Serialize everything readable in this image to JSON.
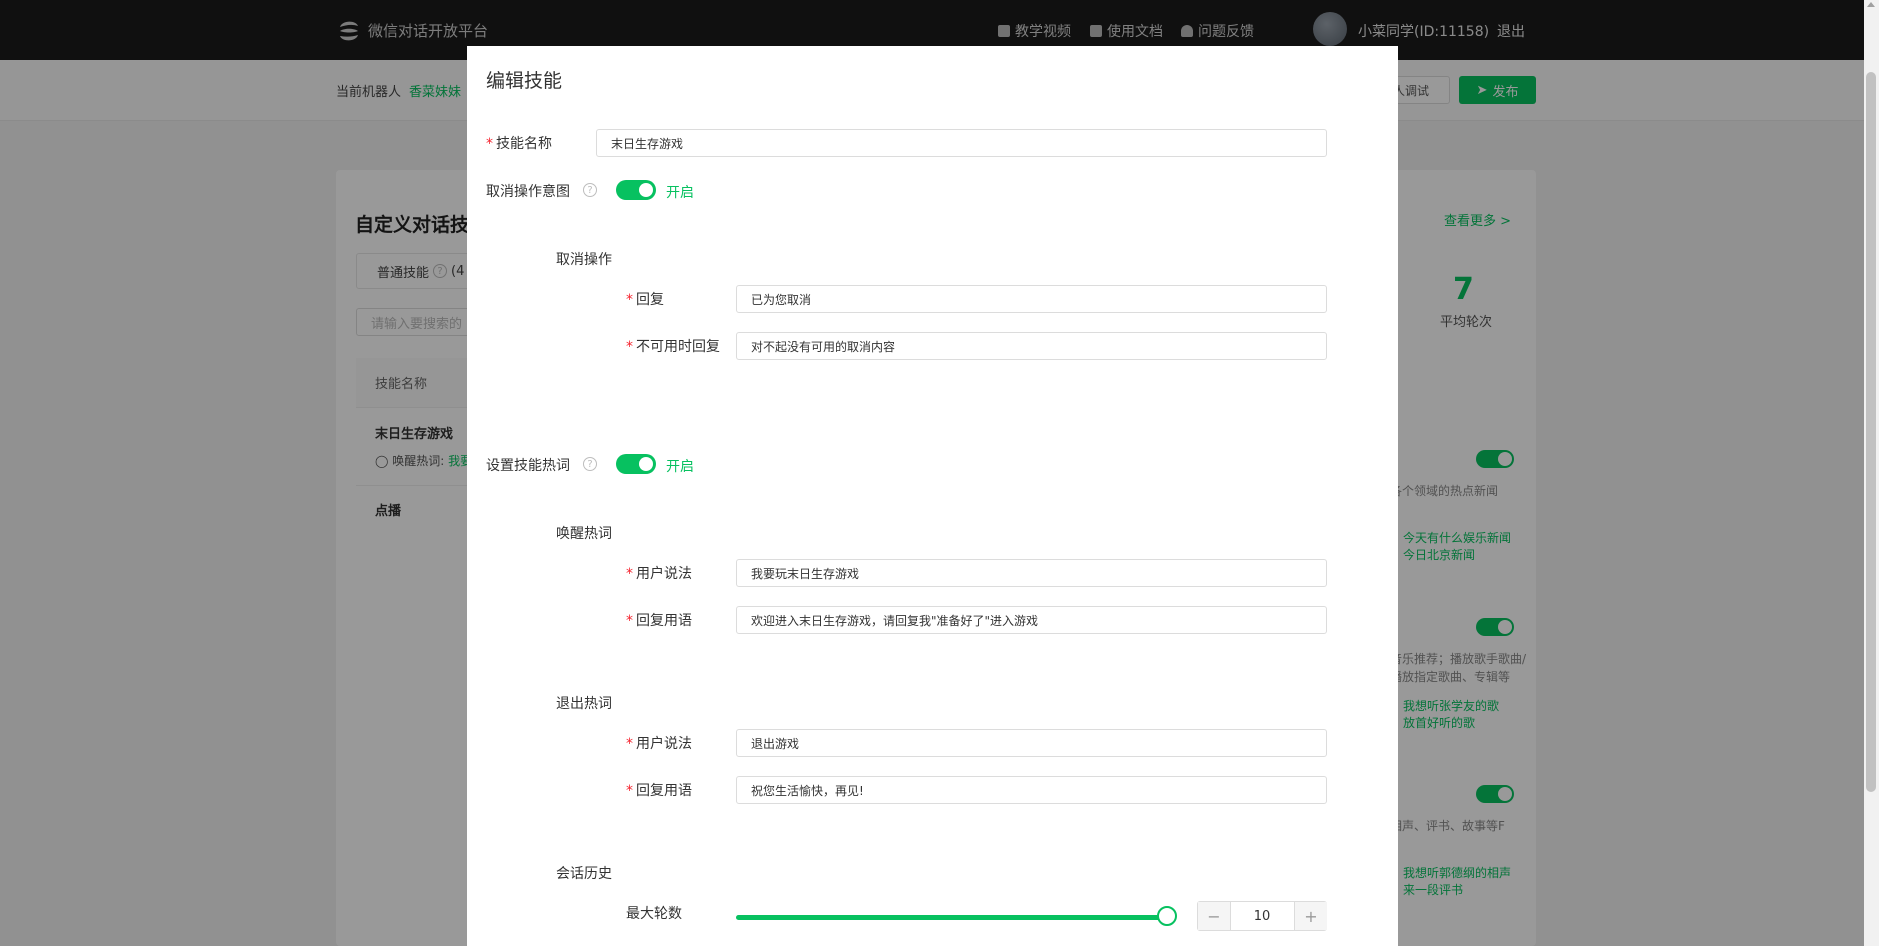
{
  "header": {
    "brand": "微信对话开放平台",
    "nav": [
      "教学视频",
      "使用文档",
      "问题反馈"
    ],
    "user": "小菜同学(ID:11158)",
    "logout": "退出"
  },
  "subbar": {
    "robot_label": "当前机器人",
    "robot_name": "香菜妹妹",
    "debug_button": "人调试",
    "publish_button": "发布"
  },
  "background": {
    "section_title": "自定义对话技",
    "tab_normal": "普通技能",
    "tab_count": "(4",
    "search_placeholder": "请输入要搜索的",
    "col_skill_name": "技能名称",
    "row1_name": "末日生存游戏",
    "row1_wake_label": "唤醒热词:",
    "row1_wake_value": "我要",
    "row2_name": "点播",
    "view_more": "查看更多 >",
    "stat_value": "7",
    "stat_label": "平均轮次",
    "cards": [
      {
        "desc": "各个领域的热点新闻",
        "examples": [
          "今天有什么娱乐新闻",
          "今日北京新闻"
        ]
      },
      {
        "desc": "音乐推荐；播放歌手歌曲/播放指定歌曲、专辑等",
        "examples": [
          "我想听张学友的歌",
          "放首好听的歌"
        ]
      },
      {
        "desc": "相声、评书、故事等F",
        "examples": [
          "我想听郭德纲的相声",
          "来一段评书"
        ]
      }
    ]
  },
  "modal": {
    "title": "编辑技能",
    "skill_name_label": "技能名称",
    "skill_name_value": "末日生存游戏",
    "cancel_intent_label": "取消操作意图",
    "cancel_intent_state": "开启",
    "cancel_section": "取消操作",
    "reply_label": "回复",
    "reply_value": "已为您取消",
    "unavailable_label": "不可用时回复",
    "unavailable_value": "对不起没有可用的取消内容",
    "hotword_label": "设置技能热词",
    "hotword_state": "开启",
    "wake_section": "唤醒热词",
    "wake_user_label": "用户说法",
    "wake_user_value": "我要玩末日生存游戏",
    "wake_reply_label": "回复用语",
    "wake_reply_value": "欢迎进入末日生存游戏，请回复我\"准备好了\"进入游戏",
    "exit_section": "退出热词",
    "exit_user_label": "用户说法",
    "exit_user_value": "退出游戏",
    "exit_reply_label": "回复用语",
    "exit_reply_value": "祝您生活愉快，再见!",
    "history_section": "会话历史",
    "max_turns_label": "最大轮数",
    "max_turns_value": "10"
  },
  "colors": {
    "accent": "#07c160",
    "required": "#f5222d",
    "topbar": "#1c1c1c"
  }
}
